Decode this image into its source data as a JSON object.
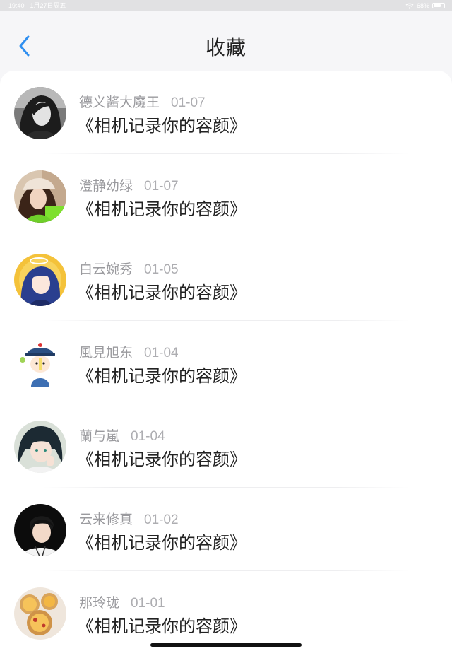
{
  "status_bar": {
    "time": "19:40",
    "date": "1月27日周五",
    "battery_text": "68%",
    "battery_level": 0.68
  },
  "header": {
    "title": "收藏"
  },
  "favorites": [
    {
      "user": "德义酱大魔王",
      "date": "01-07",
      "title": "《相机记录你的容颜》",
      "avatar": "grayscale-woman-avatar"
    },
    {
      "user": "澄静幼绿",
      "date": "01-07",
      "title": "《相机记录你的容颜》",
      "avatar": "girl-with-cap-avatar"
    },
    {
      "user": "白云婉秀",
      "date": "01-05",
      "title": "《相机记录你的容颜》",
      "avatar": "anime-blue-hair-avatar"
    },
    {
      "user": "風見旭东",
      "date": "01-04",
      "title": "《相机记录你的容颜》",
      "avatar": "cartoon-qing-official-avatar"
    },
    {
      "user": "蘭与嵐",
      "date": "01-04",
      "title": "《相机记录你的容颜》",
      "avatar": "anime-boy-avatar"
    },
    {
      "user": "云来修真",
      "date": "01-02",
      "title": "《相机记录你的容颜》",
      "avatar": "young-man-avatar"
    },
    {
      "user": "那玲珑",
      "date": "01-01",
      "title": "《相机记录你的容颜》",
      "avatar": "egg-tart-avatar"
    }
  ],
  "colors": {
    "accent": "#2f8ff0",
    "title_text": "#222222",
    "meta_text": "#9a9a9e",
    "background": "#f6f6f8"
  }
}
